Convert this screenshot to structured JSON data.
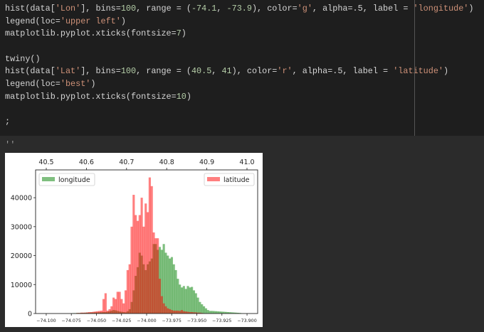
{
  "editor": {
    "code_lines": [
      [
        [
          "hist(data[",
          "plain"
        ],
        [
          "'Lon'",
          "str"
        ],
        [
          "], bins=",
          "plain"
        ],
        [
          "100",
          "num"
        ],
        [
          ", range = (",
          "plain"
        ],
        [
          "-74.1",
          "num"
        ],
        [
          ", ",
          "plain"
        ],
        [
          "-73.9",
          "num"
        ],
        [
          "), color=",
          "plain"
        ],
        [
          "'g'",
          "str"
        ],
        [
          ", alpha=.5, label = ",
          "plain"
        ],
        [
          "'longitude'",
          "str"
        ],
        [
          ")",
          "plain"
        ]
      ],
      [
        [
          "legend(loc=",
          "plain"
        ],
        [
          "'upper left'",
          "str"
        ],
        [
          ")",
          "plain"
        ]
      ],
      [
        [
          "matplotlib.pyplot.xticks(fontsize=",
          "plain"
        ],
        [
          "7",
          "num"
        ],
        [
          ")",
          "plain"
        ]
      ],
      [],
      [
        [
          "twiny()",
          "plain"
        ]
      ],
      [
        [
          "hist(data[",
          "plain"
        ],
        [
          "'Lat'",
          "str"
        ],
        [
          "], bins=",
          "plain"
        ],
        [
          "100",
          "num"
        ],
        [
          ", range = (",
          "plain"
        ],
        [
          "40.5",
          "num"
        ],
        [
          ", ",
          "plain"
        ],
        [
          "41",
          "num"
        ],
        [
          "), color=",
          "plain"
        ],
        [
          "'r'",
          "str"
        ],
        [
          ", alpha=.5, label = ",
          "plain"
        ],
        [
          "'latitude'",
          "str"
        ],
        [
          ")",
          "plain"
        ]
      ],
      [
        [
          "legend(loc=",
          "plain"
        ],
        [
          "'best'",
          "str"
        ],
        [
          ")",
          "plain"
        ]
      ],
      [
        [
          "matplotlib.pyplot.xticks(fontsize=",
          "plain"
        ],
        [
          "10",
          "num"
        ],
        [
          ")",
          "plain"
        ]
      ],
      [],
      [
        [
          ";",
          "plain"
        ]
      ]
    ]
  },
  "output": {
    "prompt": "''"
  },
  "chart_data": {
    "type": "bar",
    "title": "",
    "ylabel": "",
    "ylim": [
      0,
      49600
    ],
    "yticks": [
      0,
      10000,
      20000,
      30000,
      40000
    ],
    "ytick_labels": [
      "0",
      "10000",
      "20000",
      "30000",
      "40000"
    ],
    "grid": false,
    "series": [
      {
        "name": "longitude",
        "axis": "bottom",
        "color": "#008000",
        "alpha": 0.5,
        "range": [
          -74.1,
          -73.9
        ],
        "bins": 100,
        "xlim": [
          -74.1106,
          -73.8894
        ],
        "xticks": [
          -74.1,
          -74.075,
          -74.05,
          -74.025,
          -74.0,
          -73.975,
          -73.95,
          -73.925,
          -73.9
        ],
        "xtick_labels": [
          "−74.100",
          "−74.075",
          "−74.050",
          "−74.025",
          "−74.000",
          "−73.975",
          "−73.950",
          "−73.925",
          "−73.900"
        ],
        "values": [
          0,
          0,
          0,
          0,
          0,
          0,
          0,
          0,
          0,
          0,
          0,
          0,
          100,
          150,
          150,
          200,
          200,
          250,
          250,
          300,
          300,
          300,
          350,
          350,
          400,
          400,
          450,
          450,
          500,
          500,
          600,
          800,
          1000,
          1200,
          1100,
          900,
          700,
          600,
          500,
          400,
          800,
          1500,
          4000,
          8000,
          13000,
          16000,
          21000,
          20000,
          17000,
          15000,
          17000,
          18000,
          19000,
          24000,
          24000,
          22000,
          23000,
          22000,
          24000,
          21000,
          20000,
          19000,
          19500,
          17000,
          15000,
          12000,
          10000,
          9000,
          9500,
          8500,
          9500,
          9000,
          9200,
          8000,
          7000,
          5500,
          4000,
          3200,
          2500,
          1800,
          1200,
          900,
          900,
          850,
          800,
          750,
          700,
          650,
          600,
          550,
          500,
          450,
          400,
          350,
          300,
          250,
          200,
          100,
          50,
          0
        ]
      },
      {
        "name": "latitude",
        "axis": "top",
        "color": "#ff0000",
        "alpha": 0.5,
        "range": [
          40.5,
          41.0
        ],
        "bins": 100,
        "xlim": [
          40.4734,
          41.0266
        ],
        "xticks": [
          40.5,
          40.6,
          40.7,
          40.8,
          40.9,
          41.0
        ],
        "xtick_labels": [
          "40.5",
          "40.6",
          "40.7",
          "40.8",
          "40.9",
          "41.0"
        ],
        "values": [
          0,
          0,
          0,
          0,
          0,
          0,
          0,
          0,
          0,
          0,
          0,
          0,
          0,
          0,
          0,
          200,
          200,
          300,
          300,
          300,
          400,
          500,
          500,
          600,
          700,
          800,
          900,
          1000,
          5000,
          7000,
          1000,
          1500,
          2500,
          5500,
          5000,
          7500,
          7500,
          5000,
          3500,
          8000,
          15000,
          17000,
          30000,
          41000,
          34000,
          32000,
          34000,
          40000,
          30000,
          38000,
          35000,
          47000,
          44000,
          28000,
          26000,
          26000,
          12000,
          6000,
          3500,
          2500,
          1800,
          1500,
          1200,
          1000,
          1000,
          1000,
          900,
          1200,
          800,
          700,
          600,
          500,
          500,
          400,
          400,
          300,
          300,
          200,
          100,
          50,
          0,
          0,
          0,
          0,
          0,
          0,
          0,
          0,
          0,
          0,
          0,
          0,
          0,
          0,
          0,
          0,
          0,
          0,
          0,
          0
        ]
      }
    ],
    "legends": [
      {
        "label": "longitude",
        "loc": "upper left"
      },
      {
        "label": "latitude",
        "loc": "upper right"
      }
    ]
  }
}
